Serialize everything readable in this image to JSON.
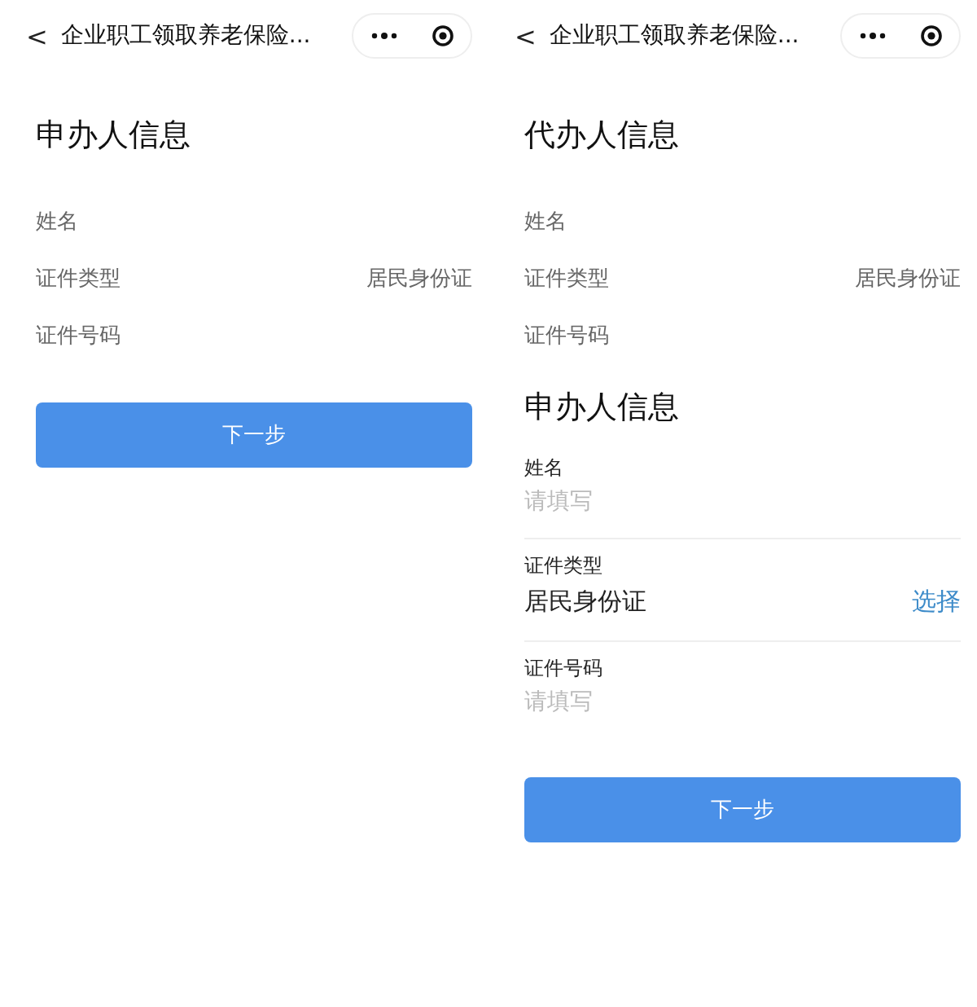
{
  "screens": [
    {
      "nav": {
        "back": "<",
        "title": "企业职工领取养老保险..."
      },
      "sections": [
        {
          "title": "申办人信息",
          "rows": [
            {
              "kind": "display",
              "label": "姓名"
            },
            {
              "kind": "display",
              "label": "证件类型",
              "value": "居民身份证"
            },
            {
              "kind": "display",
              "label": "证件号码"
            }
          ]
        }
      ],
      "button": "下一步"
    },
    {
      "nav": {
        "back": "<",
        "title": "企业职工领取养老保险..."
      },
      "sections": [
        {
          "title": "代办人信息",
          "rows": [
            {
              "kind": "display",
              "label": "姓名"
            },
            {
              "kind": "display",
              "label": "证件类型",
              "value": "居民身份证"
            },
            {
              "kind": "display",
              "label": "证件号码"
            }
          ]
        },
        {
          "title": "申办人信息",
          "rows": [
            {
              "kind": "input",
              "label": "姓名",
              "placeholder": "请填写"
            },
            {
              "kind": "select",
              "label": "证件类型",
              "value": "居民身份证",
              "action": "选择"
            },
            {
              "kind": "input",
              "label": "证件号码",
              "placeholder": "请填写"
            }
          ]
        }
      ],
      "button": "下一步"
    }
  ]
}
